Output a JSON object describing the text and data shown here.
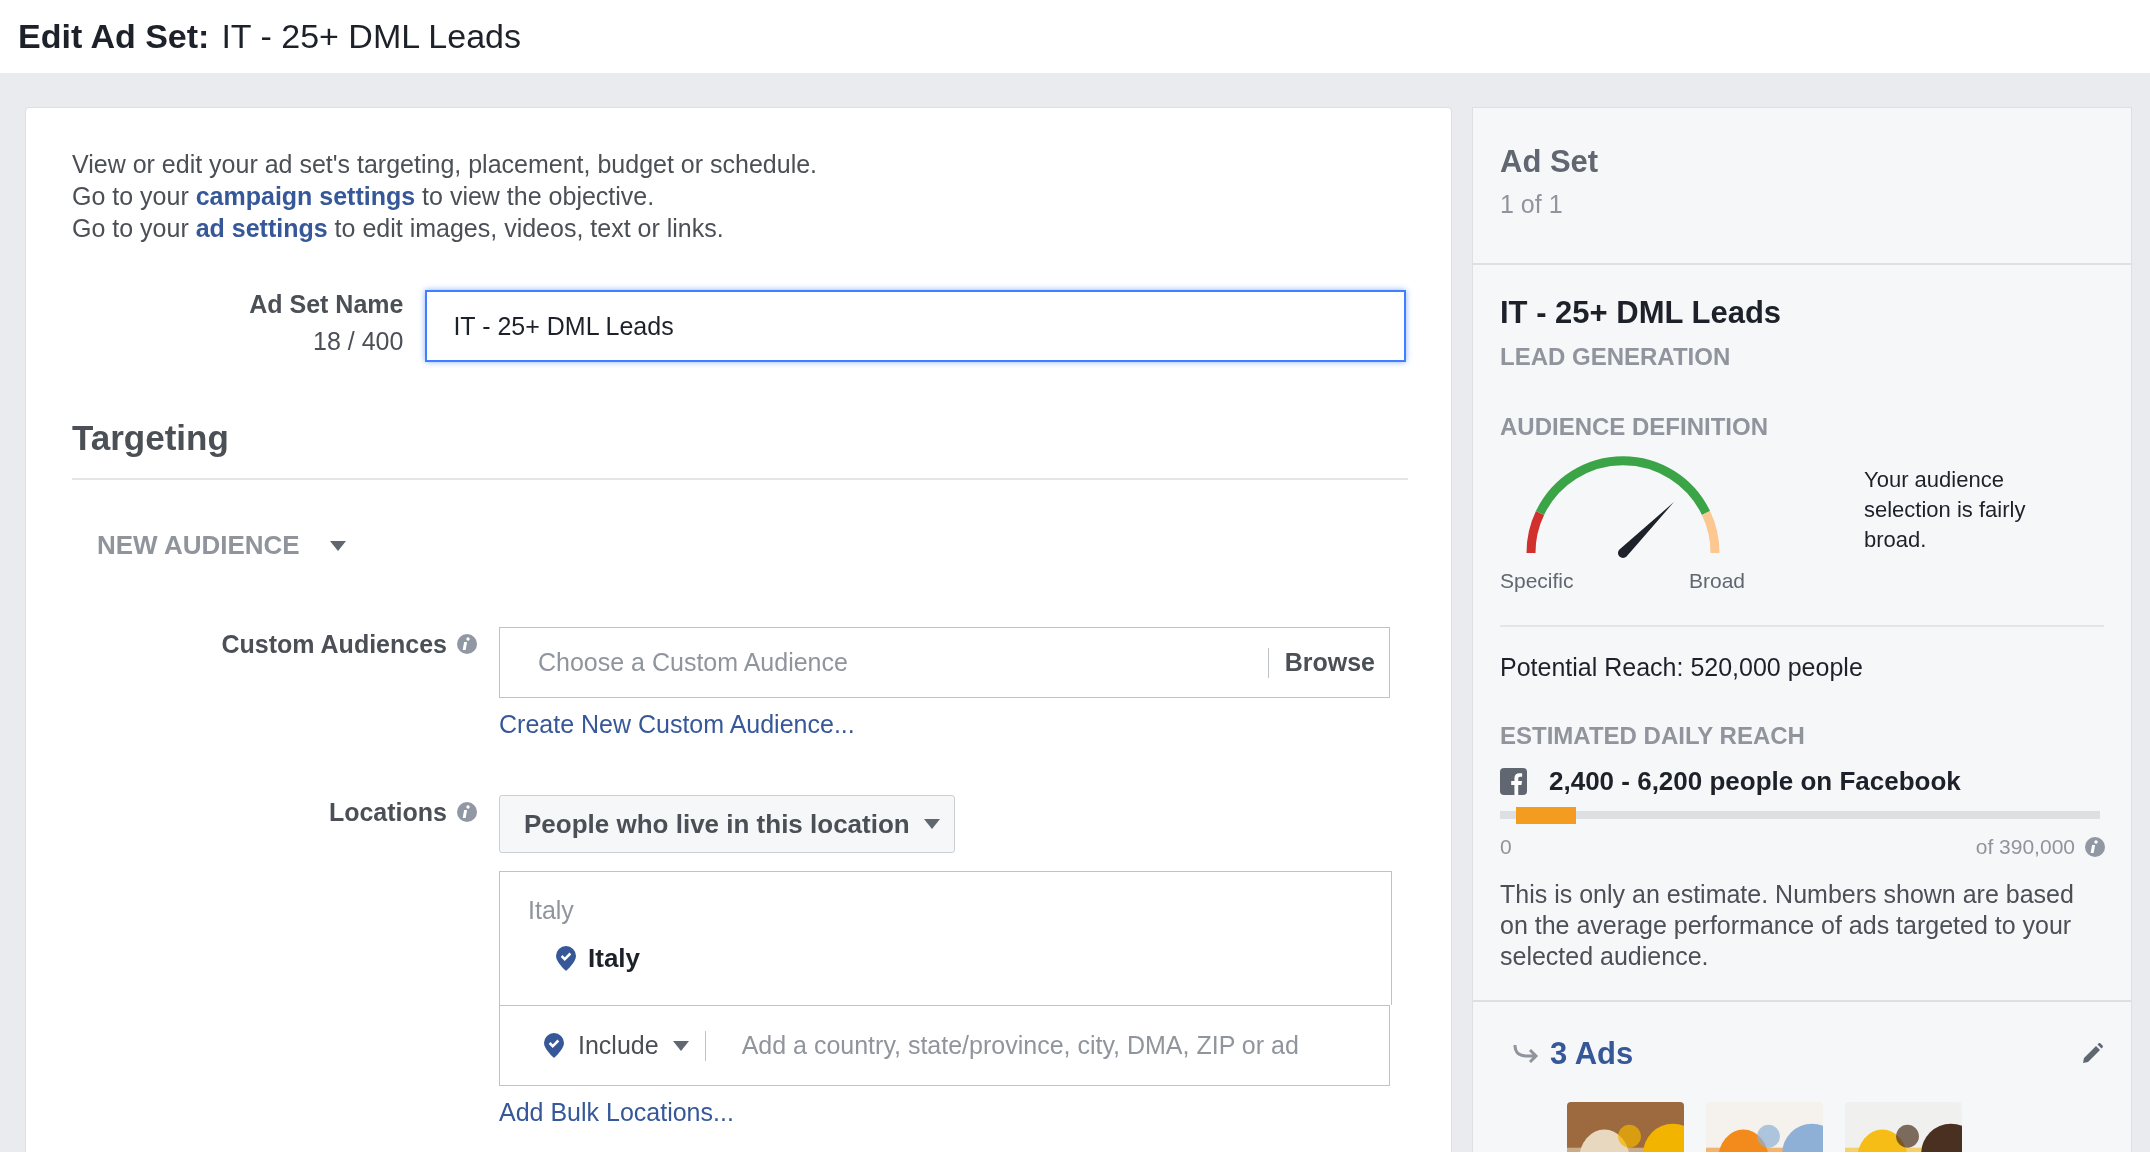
{
  "header": {
    "label": "Edit Ad Set:",
    "name": "IT - 25+ DML Leads"
  },
  "intro": [
    "View or edit your ad set's targeting, placement, budget or schedule.",
    "Go to your **campaign settings** to view the objective.",
    "Go to your **ad settings** to edit images, videos, text or links."
  ],
  "ad_set_name": {
    "label": "Ad Set Name",
    "counter": "18 / 400",
    "value": "IT - 25+ DML Leads",
    "focused": true
  },
  "targeting": {
    "title": "Targeting",
    "audience_menu": "NEW AUDIENCE",
    "custom_audiences": {
      "label": "Custom Audiences",
      "placeholder": "Choose a Custom Audience",
      "browse": "Browse",
      "link": "Create New Custom Audience..."
    },
    "locations": {
      "label": "Locations",
      "mode": "People who live in this location",
      "group": "Italy",
      "items": [
        {
          "name": "Italy"
        }
      ],
      "include": "Include",
      "placeholder": "Add a country, state/province, city, DMA, ZIP or ad",
      "link": "Add Bulk Locations..."
    }
  },
  "summary": {
    "title": "Ad Set",
    "count": "1 of 1",
    "name": "IT - 25+ DML Leads",
    "objective": "LEAD GENERATION",
    "audience_definition": {
      "title": "AUDIENCE DEFINITION",
      "level": 0.75,
      "min_label": "Specific",
      "max_label": "Broad",
      "note": "Your audience selection is fairly broad."
    },
    "potential_reach": "Potential Reach: 520,000 people",
    "daily_reach": {
      "title": "ESTIMATED DAILY REACH",
      "value": "2,400 - 6,200 people on Facebook",
      "level": 0.1,
      "min": "0",
      "max": "of 390,000",
      "note": "This is only an estimate. Numbers shown are based on the average performance of ads targeted to your selected audience."
    },
    "ads": {
      "title": "3 Ads"
    }
  }
}
